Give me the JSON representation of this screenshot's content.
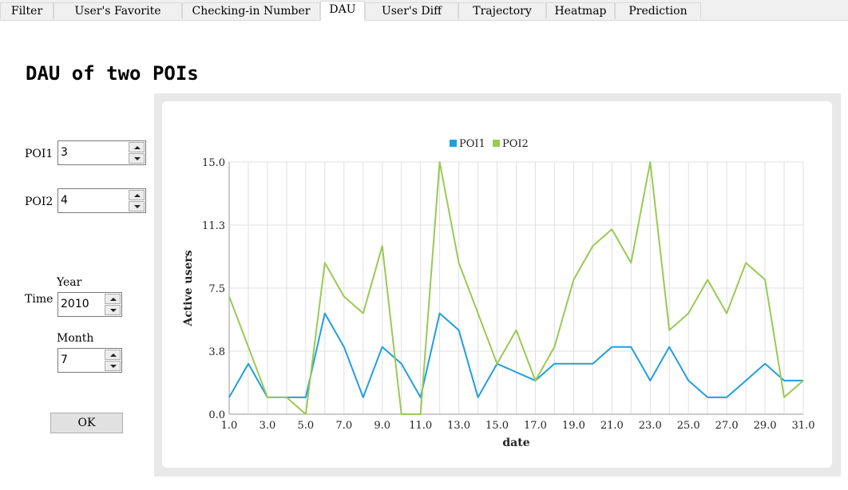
{
  "tabs": [
    {
      "label": "Filter",
      "active": false
    },
    {
      "label": "User's Favorite",
      "active": false
    },
    {
      "label": "Checking-in Number",
      "active": false
    },
    {
      "label": "DAU",
      "active": true
    },
    {
      "label": "User's Diff",
      "active": false
    },
    {
      "label": "Trajectory",
      "active": false
    },
    {
      "label": "Heatmap",
      "active": false
    },
    {
      "label": "Prediction",
      "active": false
    }
  ],
  "page_title": "DAU of two POIs",
  "form": {
    "poi1_label": "POI1",
    "poi1_value": "3",
    "poi2_label": "POI2",
    "poi2_value": "4",
    "time_label": "Time",
    "year_label": "Year",
    "year_value": "2010",
    "month_label": "Month",
    "month_value": "7",
    "ok_label": "OK"
  },
  "chart_data": {
    "type": "line",
    "xlabel": "date",
    "ylabel": "Active users",
    "xlim": [
      1,
      31
    ],
    "ylim": [
      0,
      15
    ],
    "x_ticks": [
      "1.0",
      "3.0",
      "5.0",
      "7.0",
      "9.0",
      "11.0",
      "13.0",
      "15.0",
      "17.0",
      "19.0",
      "21.0",
      "23.0",
      "25.0",
      "27.0",
      "29.0",
      "31.0"
    ],
    "y_ticks": [
      "0.0",
      "3.8",
      "7.5",
      "11.3",
      "15.0"
    ],
    "grid": true,
    "legend_position": "top",
    "x": [
      1,
      2,
      3,
      4,
      5,
      6,
      7,
      8,
      9,
      10,
      11,
      12,
      13,
      14,
      15,
      16,
      17,
      18,
      19,
      20,
      21,
      22,
      23,
      24,
      25,
      26,
      27,
      28,
      29,
      30,
      31
    ],
    "series": [
      {
        "name": "POI1",
        "color": "#209fdf",
        "values": [
          1,
          3,
          1,
          1,
          1,
          6,
          4,
          1,
          4,
          3,
          1,
          6,
          5,
          1,
          3,
          null,
          2,
          3,
          3,
          3,
          4,
          4,
          2,
          4,
          2,
          1,
          1,
          2,
          3,
          2,
          2
        ]
      },
      {
        "name": "POI2",
        "color": "#99ca53",
        "values": [
          7,
          4,
          1,
          1,
          0,
          9,
          7,
          6,
          10,
          0,
          0,
          15,
          9,
          6,
          3,
          5,
          2,
          4,
          8,
          10,
          11,
          9,
          15,
          5,
          6,
          8,
          6,
          9,
          8,
          1,
          2
        ]
      }
    ]
  }
}
